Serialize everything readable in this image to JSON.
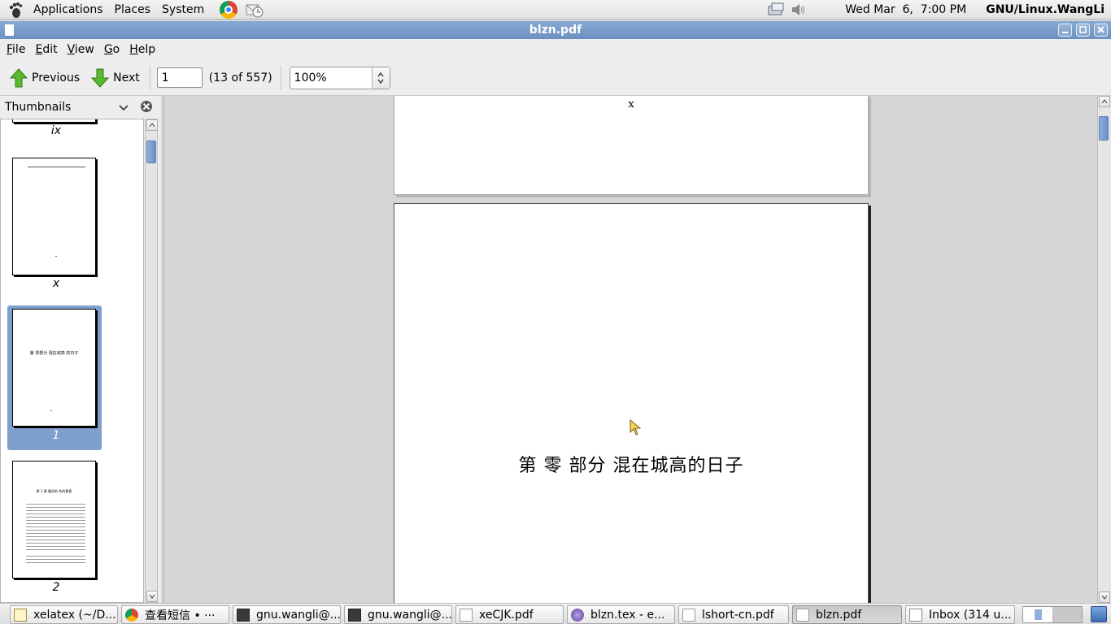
{
  "top_panel": {
    "menus": [
      "Applications",
      "Places",
      "System"
    ],
    "clock": "Wed Mar  6,  7:00 PM",
    "username": "GNU/Linux.WangLi",
    "icons": [
      "gnome-foot-icon",
      "chrome-icon",
      "mail-notify-icon",
      "network-icon",
      "volume-icon"
    ]
  },
  "window": {
    "title": "blzn.pdf"
  },
  "menubar": {
    "items": [
      {
        "key": "F",
        "rest": "ile"
      },
      {
        "key": "E",
        "rest": "dit"
      },
      {
        "key": "V",
        "rest": "iew"
      },
      {
        "key": "G",
        "rest": "o"
      },
      {
        "key": "H",
        "rest": "elp"
      }
    ]
  },
  "toolbar": {
    "previous_label": "Previous",
    "next_label": "Next",
    "page_value": "1",
    "page_count": "(13 of 557)",
    "zoom_value": "100%"
  },
  "sidebar": {
    "title": "Thumbnails",
    "thumbnails": [
      {
        "label": "ix"
      },
      {
        "label": "x"
      },
      {
        "label": "1",
        "selected": true,
        "text": "第 零部分   混在城高 的日子"
      },
      {
        "label": "2",
        "text": "第 1 章    最初的 色的黄昏"
      }
    ]
  },
  "document": {
    "top_page_numeral": "x",
    "main_page_heading": "第 零 部分  混在城高的日子"
  },
  "taskbar": {
    "tasks": [
      {
        "label": "xelatex (~/D...",
        "icon": "edit"
      },
      {
        "label": "查看短信 • ···",
        "icon": "chrome"
      },
      {
        "label": "gnu.wangli@...",
        "icon": "term"
      },
      {
        "label": "gnu.wangli@...",
        "icon": "term"
      },
      {
        "label": "xeCJK.pdf",
        "icon": "doc"
      },
      {
        "label": "blzn.tex - e...",
        "icon": "emacs"
      },
      {
        "label": "lshort-cn.pdf",
        "icon": "doc"
      },
      {
        "label": "blzn.pdf",
        "icon": "doc",
        "active": true
      },
      {
        "label": "Inbox (314 u...",
        "icon": "mail"
      }
    ]
  },
  "colors": {
    "titlebar": "#6c90c2",
    "selection": "#7f9fcc",
    "arrow_green": "#4cae2b"
  }
}
